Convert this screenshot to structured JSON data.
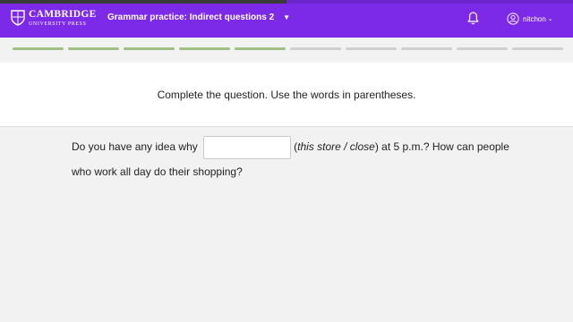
{
  "header": {
    "logo_main": "CAMBRIDGE",
    "logo_sub": "UNIVERSITY PRESS",
    "title": "Grammar practice: Indirect questions 2",
    "username": "nitchon",
    "icons": [
      "bell-icon",
      "user-icon",
      "chevron-down-icon",
      "shield-icon"
    ]
  },
  "progress": {
    "total": 10,
    "completed": 5,
    "completed_color": "#9fbf85",
    "pending_color": "#cfcfcf"
  },
  "instruction": "Complete the question. Use the words in parentheses.",
  "question": {
    "before": "Do you have any idea why",
    "answer_value": "",
    "hint_open": "(",
    "hint": "this store / close",
    "hint_close": ")",
    "after": " at 5 p.m.? How can people who work all day do their shopping?"
  },
  "colors": {
    "header_bg": "#7d2ae8",
    "page_bg": "#f2f2f2"
  }
}
